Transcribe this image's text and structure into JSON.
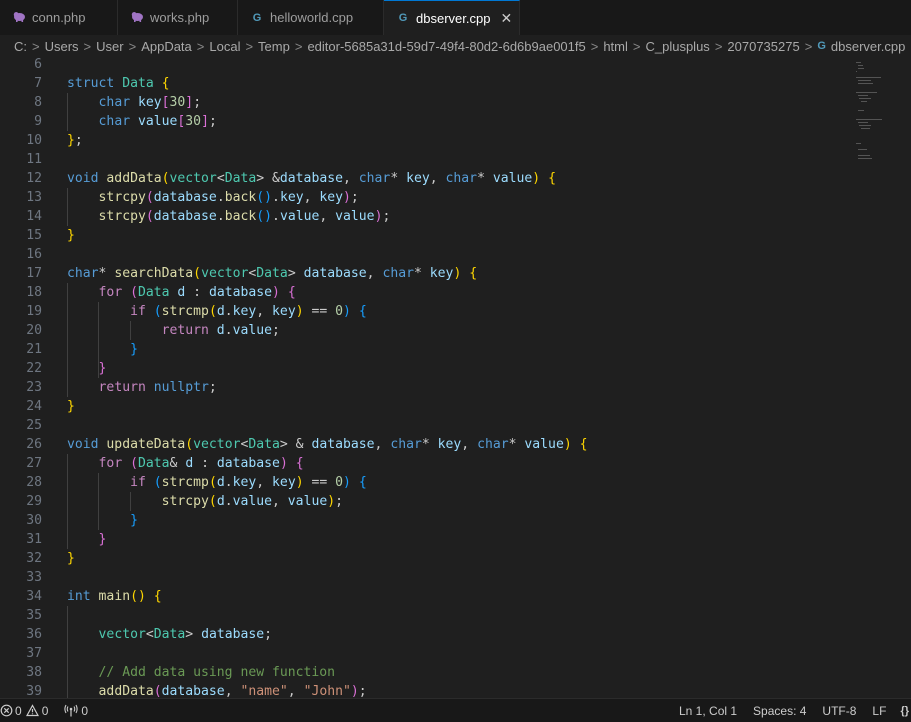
{
  "tabs": [
    {
      "label": "conn.php",
      "icon": "php-elephant-icon",
      "active": false,
      "width": 118
    },
    {
      "label": "works.php",
      "icon": "php-elephant-icon",
      "active": false,
      "width": 120
    },
    {
      "label": "helloworld.cpp",
      "icon": "cpp-file-icon",
      "active": false,
      "width": 146
    },
    {
      "label": "dbserver.cpp",
      "icon": "cpp-file-icon",
      "active": true,
      "width": 136
    }
  ],
  "breadcrumb": [
    "C:",
    "Users",
    "User",
    "AppData",
    "Local",
    "Temp",
    "editor-5685a31d-59d7-49f4-80d2-6d6b9ae001f5",
    "html",
    "C_plusplus",
    "2070735275",
    "dbserver.cpp"
  ],
  "code_lines": [
    {
      "n": "6",
      "t": []
    },
    {
      "n": "7",
      "t": [
        [
          "kw",
          "struct "
        ],
        [
          "type",
          "Data "
        ],
        [
          "b1",
          "{"
        ]
      ]
    },
    {
      "n": "8",
      "t": [
        [
          "p",
          "    "
        ],
        [
          "kw",
          "char "
        ],
        [
          "var",
          "key"
        ],
        [
          "b2",
          "["
        ],
        [
          "num",
          "30"
        ],
        [
          "b2",
          "]"
        ],
        [
          "p",
          ";"
        ]
      ]
    },
    {
      "n": "9",
      "t": [
        [
          "p",
          "    "
        ],
        [
          "kw",
          "char "
        ],
        [
          "var",
          "value"
        ],
        [
          "b2",
          "["
        ],
        [
          "num",
          "30"
        ],
        [
          "b2",
          "]"
        ],
        [
          "p",
          ";"
        ]
      ]
    },
    {
      "n": "10",
      "t": [
        [
          "b1",
          "}"
        ],
        [
          "p",
          ";"
        ]
      ]
    },
    {
      "n": "11",
      "t": []
    },
    {
      "n": "12",
      "t": [
        [
          "kw",
          "void "
        ],
        [
          "fn",
          "addData"
        ],
        [
          "b1",
          "("
        ],
        [
          "type",
          "vector"
        ],
        [
          "p",
          "<"
        ],
        [
          "type",
          "Data"
        ],
        [
          "p",
          "> &"
        ],
        [
          "var",
          "database"
        ],
        [
          "p",
          ", "
        ],
        [
          "kw",
          "char"
        ],
        [
          "p",
          "* "
        ],
        [
          "var",
          "key"
        ],
        [
          "p",
          ", "
        ],
        [
          "kw",
          "char"
        ],
        [
          "p",
          "* "
        ],
        [
          "var",
          "value"
        ],
        [
          "b1",
          ")"
        ],
        [
          "p",
          " "
        ],
        [
          "b1",
          "{"
        ]
      ]
    },
    {
      "n": "13",
      "t": [
        [
          "p",
          "    "
        ],
        [
          "fn",
          "strcpy"
        ],
        [
          "b2",
          "("
        ],
        [
          "var",
          "database"
        ],
        [
          "p",
          "."
        ],
        [
          "fn",
          "back"
        ],
        [
          "b3",
          "()"
        ],
        [
          "p",
          "."
        ],
        [
          "var",
          "key"
        ],
        [
          "p",
          ", "
        ],
        [
          "var",
          "key"
        ],
        [
          "b2",
          ")"
        ],
        [
          "p",
          ";"
        ]
      ]
    },
    {
      "n": "14",
      "t": [
        [
          "p",
          "    "
        ],
        [
          "fn",
          "strcpy"
        ],
        [
          "b2",
          "("
        ],
        [
          "var",
          "database"
        ],
        [
          "p",
          "."
        ],
        [
          "fn",
          "back"
        ],
        [
          "b3",
          "()"
        ],
        [
          "p",
          "."
        ],
        [
          "var",
          "value"
        ],
        [
          "p",
          ", "
        ],
        [
          "var",
          "value"
        ],
        [
          "b2",
          ")"
        ],
        [
          "p",
          ";"
        ]
      ]
    },
    {
      "n": "15",
      "t": [
        [
          "b1",
          "}"
        ]
      ]
    },
    {
      "n": "16",
      "t": []
    },
    {
      "n": "17",
      "t": [
        [
          "kw",
          "char"
        ],
        [
          "p",
          "* "
        ],
        [
          "fn",
          "searchData"
        ],
        [
          "b1",
          "("
        ],
        [
          "type",
          "vector"
        ],
        [
          "p",
          "<"
        ],
        [
          "type",
          "Data"
        ],
        [
          "p",
          "> "
        ],
        [
          "var",
          "database"
        ],
        [
          "p",
          ", "
        ],
        [
          "kw",
          "char"
        ],
        [
          "p",
          "* "
        ],
        [
          "var",
          "key"
        ],
        [
          "b1",
          ")"
        ],
        [
          "p",
          " "
        ],
        [
          "b1",
          "{"
        ]
      ]
    },
    {
      "n": "18",
      "t": [
        [
          "p",
          "    "
        ],
        [
          "ctl",
          "for "
        ],
        [
          "b2",
          "("
        ],
        [
          "type",
          "Data "
        ],
        [
          "var",
          "d"
        ],
        [
          "p",
          " : "
        ],
        [
          "var",
          "database"
        ],
        [
          "b2",
          ")"
        ],
        [
          "p",
          " "
        ],
        [
          "b2",
          "{"
        ]
      ]
    },
    {
      "n": "19",
      "t": [
        [
          "p",
          "        "
        ],
        [
          "ctl",
          "if "
        ],
        [
          "b3",
          "("
        ],
        [
          "fn",
          "strcmp"
        ],
        [
          "b1",
          "("
        ],
        [
          "var",
          "d"
        ],
        [
          "p",
          "."
        ],
        [
          "var",
          "key"
        ],
        [
          "p",
          ", "
        ],
        [
          "var",
          "key"
        ],
        [
          "b1",
          ")"
        ],
        [
          "p",
          " == "
        ],
        [
          "num",
          "0"
        ],
        [
          "b3",
          ")"
        ],
        [
          "p",
          " "
        ],
        [
          "b3",
          "{"
        ]
      ]
    },
    {
      "n": "20",
      "t": [
        [
          "p",
          "            "
        ],
        [
          "ctl",
          "return "
        ],
        [
          "var",
          "d"
        ],
        [
          "p",
          "."
        ],
        [
          "var",
          "value"
        ],
        [
          "p",
          ";"
        ]
      ]
    },
    {
      "n": "21",
      "t": [
        [
          "p",
          "        "
        ],
        [
          "b3",
          "}"
        ]
      ]
    },
    {
      "n": "22",
      "t": [
        [
          "p",
          "    "
        ],
        [
          "b2",
          "}"
        ]
      ]
    },
    {
      "n": "23",
      "t": [
        [
          "p",
          "    "
        ],
        [
          "ctl",
          "return "
        ],
        [
          "kw",
          "nullptr"
        ],
        [
          "p",
          ";"
        ]
      ]
    },
    {
      "n": "24",
      "t": [
        [
          "b1",
          "}"
        ]
      ]
    },
    {
      "n": "25",
      "t": []
    },
    {
      "n": "26",
      "t": [
        [
          "kw",
          "void "
        ],
        [
          "fn",
          "updateData"
        ],
        [
          "b1",
          "("
        ],
        [
          "type",
          "vector"
        ],
        [
          "p",
          "<"
        ],
        [
          "type",
          "Data"
        ],
        [
          "p",
          "> & "
        ],
        [
          "var",
          "database"
        ],
        [
          "p",
          ", "
        ],
        [
          "kw",
          "char"
        ],
        [
          "p",
          "* "
        ],
        [
          "var",
          "key"
        ],
        [
          "p",
          ", "
        ],
        [
          "kw",
          "char"
        ],
        [
          "p",
          "* "
        ],
        [
          "var",
          "value"
        ],
        [
          "b1",
          ")"
        ],
        [
          "p",
          " "
        ],
        [
          "b1",
          "{"
        ]
      ]
    },
    {
      "n": "27",
      "t": [
        [
          "p",
          "    "
        ],
        [
          "ctl",
          "for "
        ],
        [
          "b2",
          "("
        ],
        [
          "type",
          "Data"
        ],
        [
          "p",
          "& "
        ],
        [
          "var",
          "d"
        ],
        [
          "p",
          " : "
        ],
        [
          "var",
          "database"
        ],
        [
          "b2",
          ")"
        ],
        [
          "p",
          " "
        ],
        [
          "b2",
          "{"
        ]
      ]
    },
    {
      "n": "28",
      "t": [
        [
          "p",
          "        "
        ],
        [
          "ctl",
          "if "
        ],
        [
          "b3",
          "("
        ],
        [
          "fn",
          "strcmp"
        ],
        [
          "b1",
          "("
        ],
        [
          "var",
          "d"
        ],
        [
          "p",
          "."
        ],
        [
          "var",
          "key"
        ],
        [
          "p",
          ", "
        ],
        [
          "var",
          "key"
        ],
        [
          "b1",
          ")"
        ],
        [
          "p",
          " == "
        ],
        [
          "num",
          "0"
        ],
        [
          "b3",
          ")"
        ],
        [
          "p",
          " "
        ],
        [
          "b3",
          "{"
        ]
      ]
    },
    {
      "n": "29",
      "t": [
        [
          "p",
          "            "
        ],
        [
          "fn",
          "strcpy"
        ],
        [
          "b1",
          "("
        ],
        [
          "var",
          "d"
        ],
        [
          "p",
          "."
        ],
        [
          "var",
          "value"
        ],
        [
          "p",
          ", "
        ],
        [
          "var",
          "value"
        ],
        [
          "b1",
          ")"
        ],
        [
          "p",
          ";"
        ]
      ]
    },
    {
      "n": "30",
      "t": [
        [
          "p",
          "        "
        ],
        [
          "b3",
          "}"
        ]
      ]
    },
    {
      "n": "31",
      "t": [
        [
          "p",
          "    "
        ],
        [
          "b2",
          "}"
        ]
      ]
    },
    {
      "n": "32",
      "t": [
        [
          "b1",
          "}"
        ]
      ]
    },
    {
      "n": "33",
      "t": []
    },
    {
      "n": "34",
      "t": [
        [
          "kw",
          "int "
        ],
        [
          "fn",
          "main"
        ],
        [
          "b1",
          "()"
        ],
        [
          "p",
          " "
        ],
        [
          "b1",
          "{"
        ]
      ]
    },
    {
      "n": "35",
      "t": []
    },
    {
      "n": "36",
      "t": [
        [
          "p",
          "    "
        ],
        [
          "type",
          "vector"
        ],
        [
          "p",
          "<"
        ],
        [
          "type",
          "Data"
        ],
        [
          "p",
          "> "
        ],
        [
          "var",
          "database"
        ],
        [
          "p",
          ";"
        ]
      ]
    },
    {
      "n": "37",
      "t": []
    },
    {
      "n": "38",
      "t": [
        [
          "p",
          "    "
        ],
        [
          "com",
          "// Add data using new function"
        ]
      ]
    },
    {
      "n": "39",
      "t": [
        [
          "p",
          "    "
        ],
        [
          "fn",
          "addData"
        ],
        [
          "b2",
          "("
        ],
        [
          "var",
          "database"
        ],
        [
          "p",
          ", "
        ],
        [
          "str",
          "\"name\""
        ],
        [
          "p",
          ", "
        ],
        [
          "str",
          "\"John\""
        ],
        [
          "b2",
          ")"
        ],
        [
          "p",
          ";"
        ]
      ]
    }
  ],
  "status": {
    "errors": "0",
    "warnings": "0",
    "ports": "0",
    "cursor": "Ln 1, Col 1",
    "spaces": "Spaces: 4",
    "encoding": "UTF-8",
    "eol": "LF"
  },
  "colors": {
    "accent": "#0078d4",
    "editor_bg": "#1f1f1f",
    "tab_bg": "#181818"
  }
}
